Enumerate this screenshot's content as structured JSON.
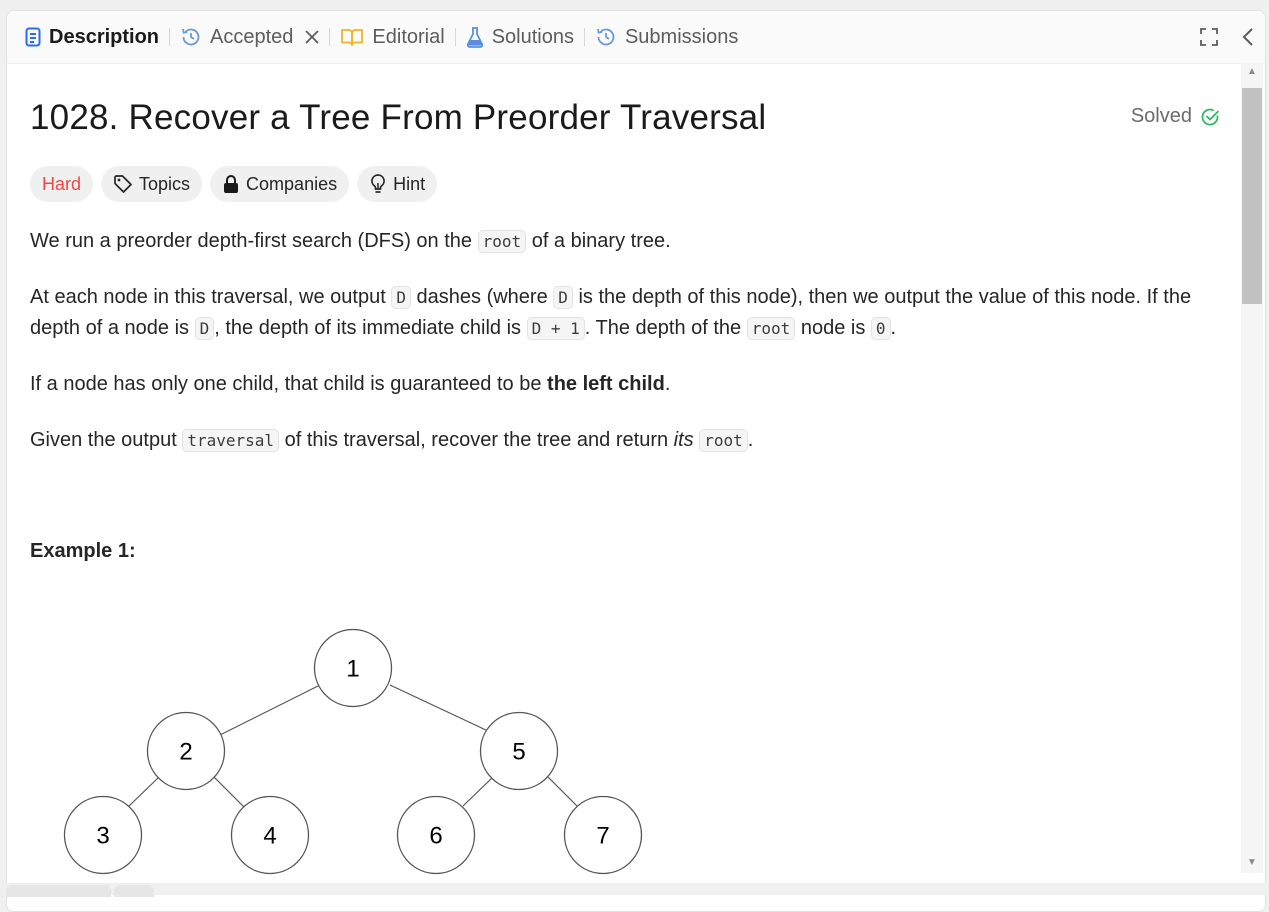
{
  "tabs": {
    "description": "Description",
    "accepted": "Accepted",
    "editorial": "Editorial",
    "solutions": "Solutions",
    "submissions": "Submissions"
  },
  "problem": {
    "title": "1028. Recover a Tree From Preorder Traversal",
    "solved_label": "Solved"
  },
  "tags": {
    "difficulty": "Hard",
    "topics": "Topics",
    "companies": "Companies",
    "hint": "Hint"
  },
  "description": {
    "p1_pre": "We run a preorder depth-first search (DFS) on the ",
    "p1_code": "root",
    "p1_post": " of a binary tree.",
    "p2_a": "At each node in this traversal, we output ",
    "p2_code1": "D",
    "p2_b": " dashes (where ",
    "p2_code2": "D",
    "p2_c": " is the depth of this node), then we output the value of this node.  If the depth of a node is ",
    "p2_code3": "D",
    "p2_d": ", the depth of its immediate child is ",
    "p2_code4": "D + 1",
    "p2_e": ".  The depth of the ",
    "p2_code5": "root",
    "p2_f": " node is ",
    "p2_code6": "0",
    "p2_g": ".",
    "p3_pre": "If a node has only one child, that child is guaranteed to be ",
    "p3_bold": "the left child",
    "p3_post": ".",
    "p4_a": "Given the output ",
    "p4_code1": "traversal",
    "p4_b": " of this traversal, recover the tree and return ",
    "p4_italic": "its",
    "p4_c": " ",
    "p4_code2": "root",
    "p4_d": "."
  },
  "example1": {
    "heading": "Example 1:",
    "tree_nodes": [
      "1",
      "2",
      "5",
      "3",
      "4",
      "6",
      "7"
    ]
  },
  "colors": {
    "hard": "#ef4743",
    "solved_check": "#2cbb5d",
    "description_icon": "#2a6bf2",
    "history_icon": "#6a9bd8",
    "editorial_icon": "#f2b32a",
    "solutions_icon": "#5a8fe0"
  }
}
